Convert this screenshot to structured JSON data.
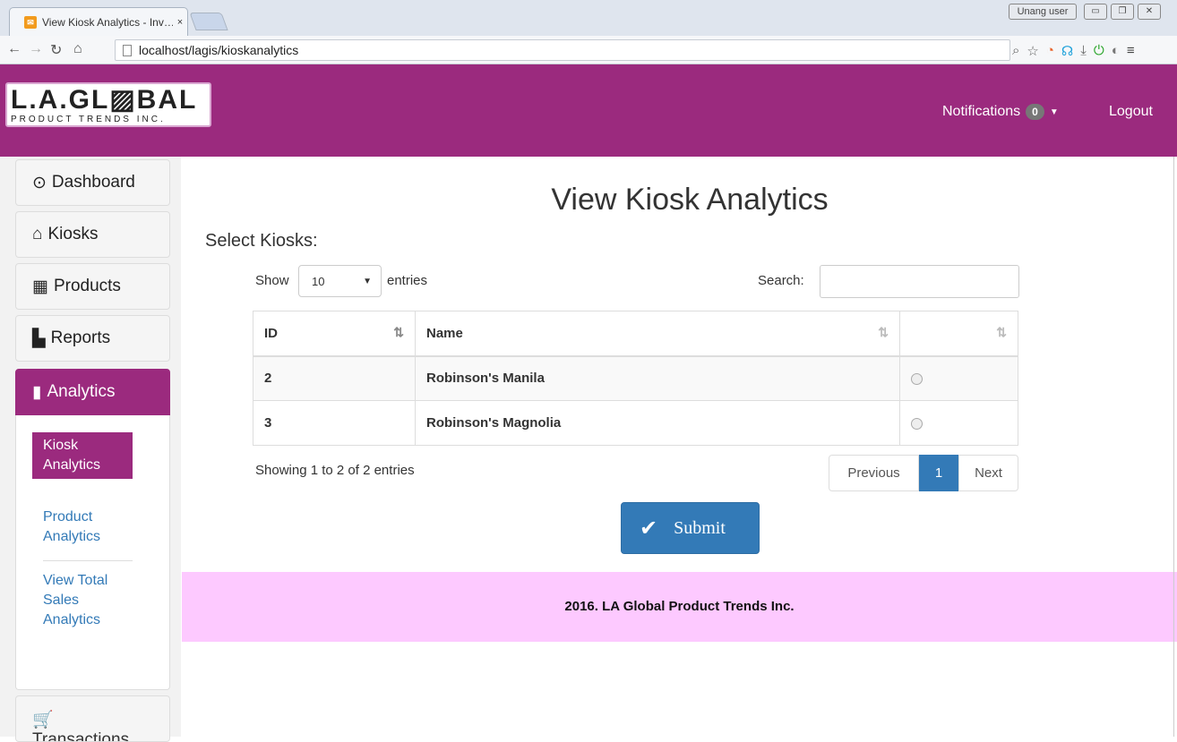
{
  "browser": {
    "tab_title": "View Kiosk Analytics - Inv…",
    "tab_close": "×",
    "user_badge": "Unang user",
    "url": "localhost/lagis/kioskanalytics"
  },
  "header": {
    "logo_big": "L.A.GL▨BAL",
    "logo_small": "PRODUCT TRENDS INC.",
    "notifications_label": "Notifications",
    "notifications_count": "0",
    "logout_label": "Logout"
  },
  "sidebar": {
    "items": [
      {
        "label": "Dashboard",
        "icon": "dashboard-icon"
      },
      {
        "label": "Kiosks",
        "icon": "home-icon"
      },
      {
        "label": "Products",
        "icon": "briefcase-icon"
      },
      {
        "label": "Reports",
        "icon": "file-icon"
      },
      {
        "label": "Analytics",
        "icon": "bar-chart-icon"
      }
    ],
    "submenu": [
      {
        "label": "Kiosk Analytics"
      },
      {
        "label": "Product Analytics"
      },
      {
        "label": "View Total Sales Analytics"
      }
    ],
    "bottom_item": {
      "label": "Transactions",
      "icon": "cart-icon"
    }
  },
  "main": {
    "title": "View Kiosk Analytics",
    "select_label": "Select Kiosks:",
    "show_label": "Show",
    "length_value": "10",
    "entries_label": "entries",
    "search_label": "Search:",
    "columns": [
      "ID",
      "Name",
      ""
    ],
    "rows": [
      {
        "id": "2",
        "name": "Robinson's Manila"
      },
      {
        "id": "3",
        "name": "Robinson's Magnolia"
      }
    ],
    "info": "Showing 1 to 2 of 2 entries",
    "pager": {
      "previous": "Previous",
      "current": "1",
      "next": "Next"
    },
    "submit_label": "Submit"
  },
  "footer": {
    "text": "2016. LA Global Product Trends Inc."
  },
  "colors": {
    "header_bg": "#9b2a7e",
    "footer_bg": "#fdc9ff",
    "primary": "#337ab7"
  }
}
